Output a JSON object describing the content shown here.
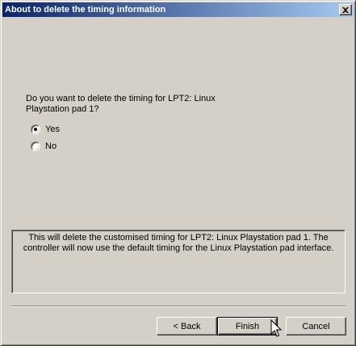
{
  "window": {
    "title": "About to delete the timing information",
    "close_icon": "close-icon"
  },
  "question": {
    "text": "Do you want to delete the timing for LPT2: Linux Playstation pad 1?"
  },
  "options": [
    {
      "label": "Yes",
      "selected": true
    },
    {
      "label": "No",
      "selected": false
    }
  ],
  "info": {
    "text": "This will delete the customised timing for LPT2: Linux Playstation pad 1. The controller will now use the default timing for the Linux Playstation pad interface."
  },
  "buttons": {
    "back": "< Back",
    "finish": "Finish",
    "cancel": "Cancel"
  },
  "colors": {
    "titlebar_start": "#0a246a",
    "titlebar_end": "#a6caf0",
    "face": "#d4d0c8"
  }
}
